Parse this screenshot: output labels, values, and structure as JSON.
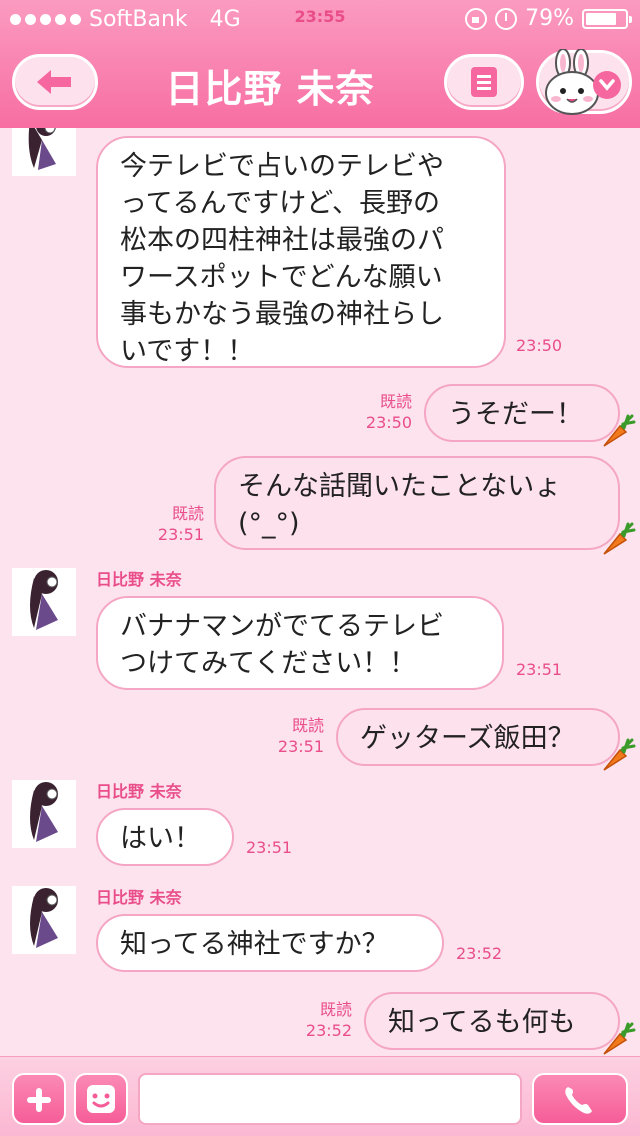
{
  "status_bar": {
    "carrier": "SoftBank",
    "network": "4G",
    "time": "23:55",
    "battery": "79%",
    "battery_level": 0.79
  },
  "header": {
    "title": "日比野 未奈"
  },
  "colors": {
    "header_pink": "#f76ea3",
    "chat_bg": "#fde3ee",
    "accent": "#e94d8a"
  },
  "messages": [
    {
      "side": "in",
      "sender": "",
      "text": "今テレビで占いのテレビや\nってるんですけど、長野の\n松本の四柱神社は最強のパ\nワースポットでどんな願い\n事もかなう最強の神社らし\nいです！！",
      "time": "23:50"
    },
    {
      "side": "out",
      "read": "既読",
      "text": "うそだー！",
      "time": "23:50"
    },
    {
      "side": "out",
      "read": "既読",
      "text": "そんな話聞いたことないょ\n(°_°)",
      "time": "23:51"
    },
    {
      "side": "in",
      "sender": "日比野 未奈",
      "text": "バナナマンがでてるテレビ\nつけてみてください！！",
      "time": "23:51"
    },
    {
      "side": "out",
      "read": "既読",
      "text": "ゲッターズ飯田？",
      "time": "23:51"
    },
    {
      "side": "in",
      "sender": "日比野 未奈",
      "text": "はい！",
      "time": "23:51"
    },
    {
      "side": "in",
      "sender": "日比野 未奈",
      "text": "知ってる神社ですか？",
      "time": "23:52"
    },
    {
      "side": "out",
      "read": "既読",
      "text": "知ってるも何も",
      "time": "23:52"
    }
  ],
  "composer": {
    "input_value": ""
  }
}
